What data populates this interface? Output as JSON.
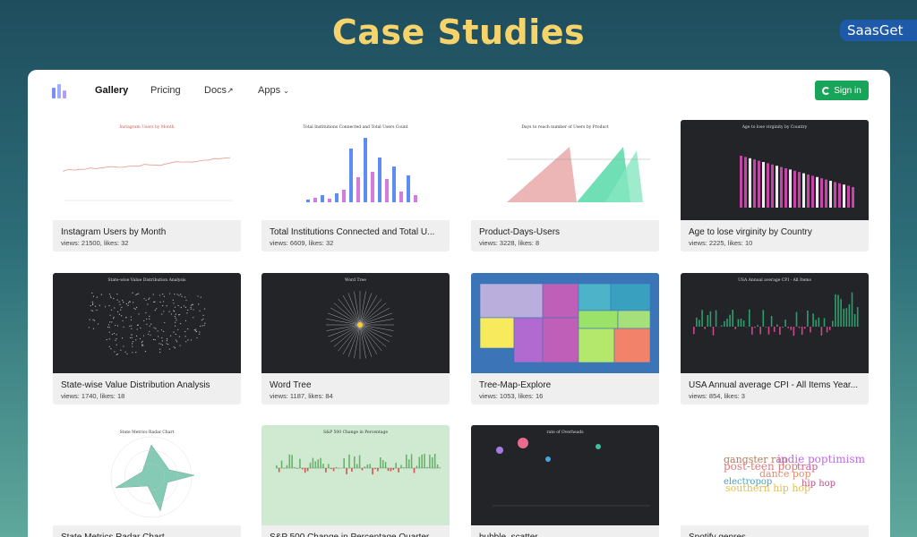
{
  "hero": {
    "title": "Case Studies"
  },
  "brand": {
    "label": "SaasGet"
  },
  "nav": {
    "links": [
      "Gallery",
      "Pricing",
      "Docs",
      "Apps"
    ],
    "signin": "Sign in",
    "colors": {
      "signin": "#18a55a"
    }
  },
  "cards": [
    {
      "title": "Instagram Users by Month",
      "meta": "views: 21500, likes: 32",
      "thumb_title": "Instagram Users by Month",
      "theme": "light",
      "chart": "line"
    },
    {
      "title": "Total Institutions Connected and Total U...",
      "meta": "views: 6609, likes: 32",
      "thumb_title": "Total Institutions Connected and Total Users Count",
      "theme": "light",
      "chart": "bars"
    },
    {
      "title": "Product-Days-Users",
      "meta": "views: 3228, likes: 8",
      "thumb_title": "Days to reach number of Users by Product",
      "theme": "light",
      "chart": "area"
    },
    {
      "title": "Age to lose virginity by Country",
      "meta": "views: 2225, likes: 10",
      "thumb_title": "Age to lose virginity by Country",
      "theme": "dark",
      "chart": "bardesc"
    },
    {
      "title": "State-wise Value Distribution Analysis",
      "meta": "views: 1740, likes: 18",
      "thumb_title": "State-wise Value Distribution Analysis",
      "theme": "dark",
      "chart": "map"
    },
    {
      "title": "Word Tree",
      "meta": "views: 1187, likes: 84",
      "thumb_title": "Word Tree",
      "theme": "dark",
      "chart": "radial"
    },
    {
      "title": "Tree-Map-Explore",
      "meta": "views: 1053, likes: 16",
      "thumb_title": "",
      "theme": "blue",
      "chart": "treemap"
    },
    {
      "title": "USA Annual average CPI - All Items Year...",
      "meta": "views: 854, likes: 3",
      "thumb_title": "USA Annual average CPI - All Items",
      "theme": "dark",
      "chart": "cpi"
    },
    {
      "title": "State Metrics Radar Chart",
      "meta": "",
      "thumb_title": "State Metrics Radar Chart",
      "theme": "light",
      "chart": "radar"
    },
    {
      "title": "S&P 500 Change in Percentage Quarter",
      "meta": "",
      "thumb_title": "S&P 500 Change in Percentage",
      "theme": "green",
      "chart": "sp"
    },
    {
      "title": "bubble_scatter",
      "meta": "",
      "thumb_title": "rate of Overheads",
      "theme": "dark",
      "chart": "bubble"
    },
    {
      "title": "Spotify genres",
      "meta": "",
      "thumb_title": "",
      "theme": "light",
      "chart": "wordcloud",
      "words": [
        "gangster rap",
        "indie poptimism",
        "post-teen pop",
        "trap",
        "dance pop",
        "electropop",
        "southern hip hop",
        "hip hop"
      ]
    }
  ]
}
